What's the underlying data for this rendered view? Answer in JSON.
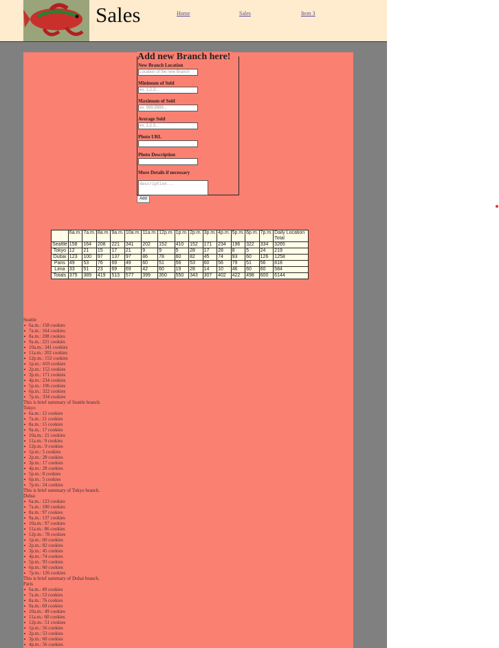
{
  "header": {
    "title": "Sales",
    "nav": [
      "Home",
      "Sales",
      "Item 3"
    ]
  },
  "form": {
    "legend": "Add new Branch here!",
    "fields": [
      {
        "label": "New Branch Location",
        "placeholder": "Location of the new Branch"
      },
      {
        "label": "Minimum of Sold",
        "placeholder": "ex. 1,2,3..."
      },
      {
        "label": "Maximum of Sold",
        "placeholder": "ex. 999,9999..."
      },
      {
        "label": "Average Sold",
        "placeholder": "ex. 1,2,3..."
      },
      {
        "label": "Photo URL",
        "placeholder": ""
      },
      {
        "label": "Photo Description",
        "placeholder": ""
      },
      {
        "label": "More Details if necessary",
        "placeholder": "description..."
      }
    ],
    "submit_label": "Add"
  },
  "table": {
    "headers": [
      "",
      "6a.m.",
      "7a.m.",
      "8a.m.",
      "9a.m.",
      "10a.m.",
      "11a.m.",
      "12p.m.",
      "1p.m.",
      "2p.m.",
      "3p.m.",
      "4p.m.",
      "5p.m.",
      "6p.m.",
      "7p.m.",
      "Daily Location Total"
    ],
    "rows": [
      [
        "Seattle",
        "158",
        "164",
        "208",
        "221",
        "341",
        "202",
        "152",
        "410",
        "152",
        "171",
        "234",
        "196",
        "322",
        "334",
        "3265"
      ],
      [
        "Tokyo",
        "12",
        "21",
        "15",
        "17",
        "21",
        "9",
        "9",
        "5",
        "28",
        "17",
        "28",
        "8",
        "5",
        "24",
        "219"
      ],
      [
        "Dubai",
        "123",
        "100",
        "97",
        "137",
        "97",
        "86",
        "78",
        "60",
        "82",
        "45",
        "74",
        "93",
        "60",
        "126",
        "1258"
      ],
      [
        "Paris",
        "49",
        "53",
        "76",
        "69",
        "49",
        "60",
        "51",
        "56",
        "53",
        "60",
        "56",
        "79",
        "51",
        "56",
        "818"
      ],
      [
        "Lima",
        "33",
        "51",
        "23",
        "69",
        "69",
        "42",
        "60",
        "19",
        "28",
        "14",
        "10",
        "46",
        "60",
        "60",
        "584"
      ],
      [
        "Totals",
        "375",
        "389",
        "419",
        "513",
        "577",
        "399",
        "350",
        "550",
        "343",
        "307",
        "402",
        "422",
        "498",
        "600",
        "6144"
      ]
    ]
  },
  "locations": [
    {
      "name": "Seattle",
      "items": [
        "6a.m.: 158 cookies",
        "7a.m.: 164 cookies",
        "8a.m.: 208 cookies",
        "9a.m.: 221 cookies",
        "10a.m.: 341 cookies",
        "11a.m.: 202 cookies",
        "12p.m.: 152 cookies",
        "1p.m.: 410 cookies",
        "2p.m.: 152 cookies",
        "3p.m.: 171 cookies",
        "4p.m.: 234 cookies",
        "5p.m.: 196 cookies",
        "6p.m.: 322 cookies",
        "7p.m.: 334 cookies"
      ],
      "summary": "This is brief summary of Seattle branch."
    },
    {
      "name": "Tokyo",
      "items": [
        "6a.m.: 12 cookies",
        "7a.m.: 21 cookies",
        "8a.m.: 15 cookies",
        "9a.m.: 17 cookies",
        "10a.m.: 21 cookies",
        "11a.m.: 9 cookies",
        "12p.m.: 9 cookies",
        "1p.m.: 5 cookies",
        "2p.m.: 28 cookies",
        "3p.m.: 17 cookies",
        "4p.m.: 28 cookies",
        "5p.m.: 8 cookies",
        "6p.m.: 5 cookies",
        "7p.m.: 24 cookies"
      ],
      "summary": "This is brief summary of Tokyo branch."
    },
    {
      "name": "Dubai",
      "items": [
        "6a.m.: 123 cookies",
        "7a.m.: 100 cookies",
        "8a.m.: 97 cookies",
        "9a.m.: 137 cookies",
        "10a.m.: 97 cookies",
        "11a.m.: 86 cookies",
        "12p.m.: 78 cookies",
        "1p.m.: 60 cookies",
        "2p.m.: 82 cookies",
        "3p.m.: 45 cookies",
        "4p.m.: 74 cookies",
        "5p.m.: 93 cookies",
        "6p.m.: 60 cookies",
        "7p.m.: 126 cookies"
      ],
      "summary": "This is brief summary of Dubai branch."
    },
    {
      "name": "Paris",
      "items": [
        "6a.m.: 49 cookies",
        "7a.m.: 53 cookies",
        "8a.m.: 76 cookies",
        "9a.m.: 69 cookies",
        "10a.m.: 49 cookies",
        "11a.m.: 60 cookies",
        "12p.m.: 51 cookies",
        "1p.m.: 56 cookies",
        "2p.m.: 53 cookies",
        "3p.m.: 60 cookies",
        "4p.m.: 56 cookies"
      ],
      "summary": ""
    }
  ]
}
